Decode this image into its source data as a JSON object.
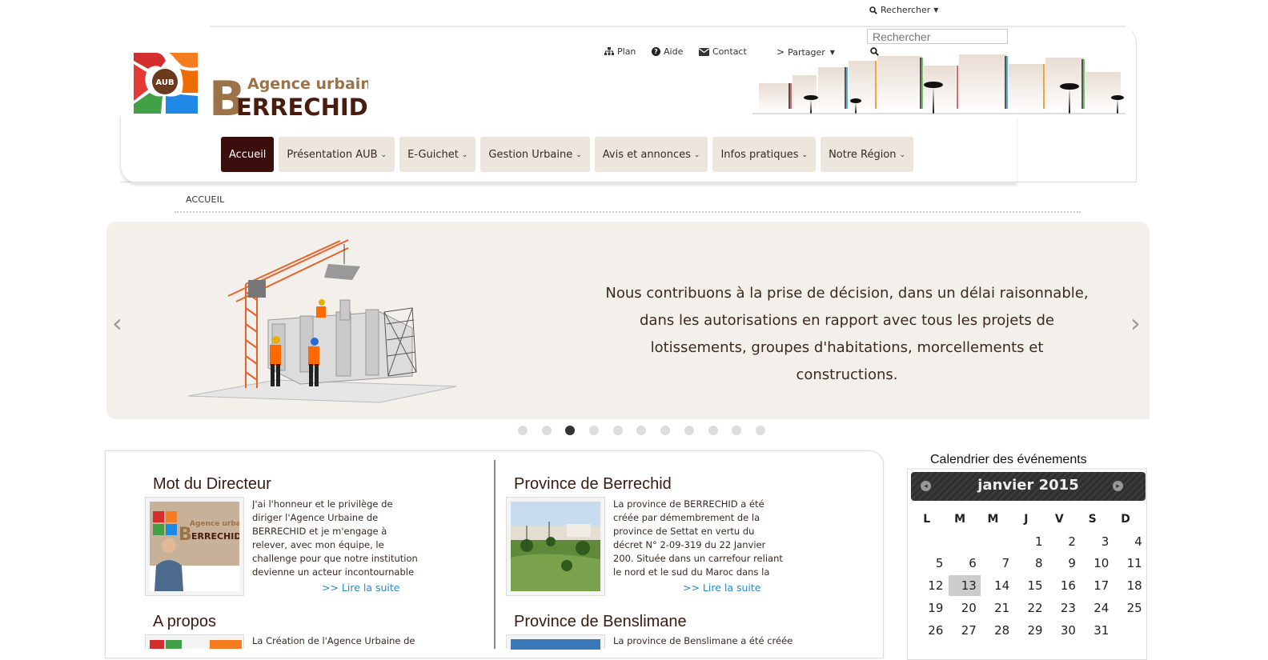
{
  "topbar": {
    "search_toggle": "Rechercher",
    "search_placeholder": "Rechercher"
  },
  "toplinks": {
    "plan": "Plan",
    "aide": "Aide",
    "contact": "Contact",
    "partager": "Partager"
  },
  "logo": {
    "badge": "AUB",
    "line1": "Agence urbaine",
    "big_letter": "B",
    "line2": "ERRECHID"
  },
  "nav": [
    {
      "label": "Accueil",
      "active": true
    },
    {
      "label": "Présentation AUB"
    },
    {
      "label": "E-Guichet"
    },
    {
      "label": "Gestion Urbaine"
    },
    {
      "label": "Avis et annonces"
    },
    {
      "label": "Infos pratiques"
    },
    {
      "label": "Notre Région"
    }
  ],
  "breadcrumb": "ACCUEIL",
  "slider": {
    "text": "Nous contribuons à la prise de décision, dans un délai raisonnable, dans les autorisations en rapport avec tous les projets de lotissements, groupes d'habitations, morcellements et constructions.",
    "dots": 11,
    "active_dot": 3
  },
  "sections": {
    "directeur": {
      "title": "Mot du Directeur",
      "text": "J'ai l'honneur et le privilège de diriger l'Agence Urbaine de BERRECHID et je m'engage à relever, avec mon équipe, le challenge pour que notre institution devienne un acteur incontournable dans le développement de la région",
      "more": ">> Lire la suite",
      "thumb_line1": "Agence urbaine",
      "thumb_line2": "ERRECHID"
    },
    "berrechid": {
      "title": "Province de Berrechid",
      "text": "La province de BERRECHID a été créée par démembrement de la province de Settat en vertu du décret N° 2-09-319 du 22 Janvier 200. Située dans un carrefour reliant le nord et le sud du Maroc dans la plaine de Chaouia. Elle",
      "more": ">> Lire la suite"
    },
    "apropos": {
      "title": "A propos",
      "text": "La Création de l'Agence Urbaine de"
    },
    "benslimane": {
      "title": "Province de Benslimane",
      "text": "La province de Benslimane a été créée"
    }
  },
  "calendar": {
    "title": "Calendrier des événements",
    "month": "janvier 2015",
    "prev": "◂",
    "next": "▸",
    "headers": [
      "L",
      "M",
      "M",
      "J",
      "V",
      "S",
      "D"
    ],
    "weeks": [
      [
        "",
        "",
        "",
        "1",
        "2",
        "3",
        "4"
      ],
      [
        "5",
        "6",
        "7",
        "8",
        "9",
        "10",
        "11"
      ],
      [
        "12",
        "13",
        "14",
        "15",
        "16",
        "17",
        "18"
      ],
      [
        "19",
        "20",
        "21",
        "22",
        "23",
        "24",
        "25"
      ],
      [
        "26",
        "27",
        "28",
        "29",
        "30",
        "31",
        ""
      ]
    ],
    "today": "13"
  },
  "colors": {
    "brand_dark": "#3b0d0d",
    "nav_bg": "#ece6dc",
    "logo_brown": "#9c7248",
    "link": "#2a8ac4"
  }
}
